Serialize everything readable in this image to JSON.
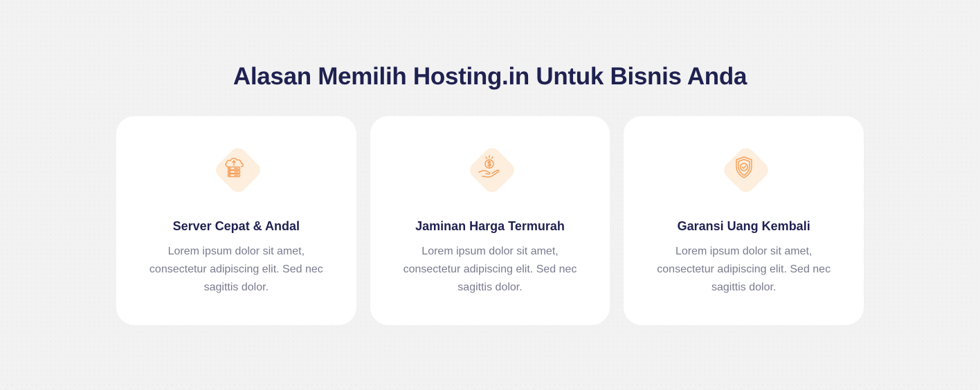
{
  "section": {
    "title": "Alasan Memilih Hosting.in Untuk Bisnis Anda"
  },
  "colors": {
    "background": "#f2f2f2",
    "card": "#ffffff",
    "heading": "#1f2150",
    "body_text": "#7a7b8f",
    "icon_accent": "#f4a15d",
    "icon_bg": "#fdeedd"
  },
  "cards": [
    {
      "icon": "cloud-server-icon",
      "title": "Server Cepat & Andal",
      "text": "Lorem ipsum dolor sit amet, consectetur adipiscing elit. Sed nec sagittis dolor."
    },
    {
      "icon": "hand-coin-icon",
      "title": "Jaminan Harga Termurah",
      "text": "Lorem ipsum dolor sit amet, consectetur adipiscing elit. Sed nec sagittis dolor."
    },
    {
      "icon": "shield-check-icon",
      "title": "Garansi Uang Kembali",
      "text": "Lorem ipsum dolor sit amet, consectetur adipiscing elit. Sed nec sagittis dolor."
    }
  ]
}
